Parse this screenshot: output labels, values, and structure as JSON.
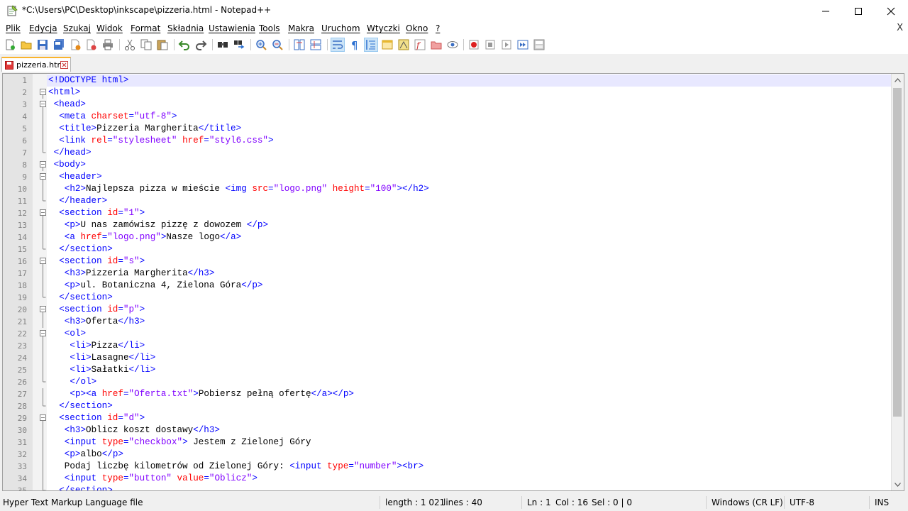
{
  "window": {
    "title": "*C:\\Users\\PC\\Desktop\\inkscape\\pizzeria.html - Notepad++",
    "icons": [
      "minimize-icon",
      "maximize-icon",
      "close-icon"
    ]
  },
  "menu": {
    "items": [
      "Plik",
      "Edycja",
      "Szukaj",
      "Widok",
      "Format",
      "Składnia",
      "Ustawienia",
      "Tools",
      "Makra",
      "Uruchom",
      "Wtyczki",
      "Okno",
      "?"
    ],
    "close": "X"
  },
  "toolbar": {
    "icons": [
      "new-file-icon",
      "open-file-icon",
      "save-icon",
      "save-all-icon",
      "close-icon",
      "close-all-icon",
      "print-icon",
      "cut-icon",
      "copy-icon",
      "paste-icon",
      "undo-icon",
      "redo-icon",
      "find-icon",
      "replace-icon",
      "zoom-in-icon",
      "zoom-out-icon",
      "sync-vertical-icon",
      "sync-horizontal-icon",
      "word-wrap-icon",
      "show-all-chars-icon",
      "indent-guide-icon",
      "user-defined-lang-icon",
      "document-map-icon",
      "function-list-icon",
      "folder-workspace-icon",
      "monitoring-icon",
      "record-macro-icon",
      "stop-record-icon",
      "play-macro-icon",
      "run-macro-multiple-icon",
      "save-macro-icon"
    ]
  },
  "tab": {
    "label": "pizzeria.html",
    "accent": "#fab42d"
  },
  "editor": {
    "current_line": 1,
    "lines": [
      {
        "n": "1",
        "indent": 0,
        "fold": "",
        "tokens": [
          [
            "doc",
            "<!DOCTYPE html>"
          ]
        ]
      },
      {
        "n": "2",
        "indent": 0,
        "fold": "minus",
        "tokens": [
          [
            "tag",
            "<html>"
          ]
        ]
      },
      {
        "n": "3",
        "indent": 1,
        "fold": "minus",
        "tokens": [
          [
            "tag",
            "<head>"
          ]
        ]
      },
      {
        "n": "4",
        "indent": 2,
        "fold": "line",
        "tokens": [
          [
            "tag",
            "<meta "
          ],
          [
            "attr",
            "charset"
          ],
          [
            "tag",
            "="
          ],
          [
            "str",
            "\"utf-8\""
          ],
          [
            "tag",
            ">"
          ]
        ]
      },
      {
        "n": "5",
        "indent": 2,
        "fold": "line",
        "tokens": [
          [
            "tag",
            "<title>"
          ],
          [
            "txt",
            "Pizzeria Margherita"
          ],
          [
            "tag",
            "</title>"
          ]
        ]
      },
      {
        "n": "6",
        "indent": 2,
        "fold": "line",
        "tokens": [
          [
            "tag",
            "<link "
          ],
          [
            "attr",
            "rel"
          ],
          [
            "tag",
            "="
          ],
          [
            "str",
            "\"stylesheet\""
          ],
          [
            "tag",
            " "
          ],
          [
            "attr",
            "href"
          ],
          [
            "tag",
            "="
          ],
          [
            "str",
            "\"styl6.css\""
          ],
          [
            "tag",
            ">"
          ]
        ]
      },
      {
        "n": "7",
        "indent": 1,
        "fold": "end",
        "tokens": [
          [
            "tag",
            "</head>"
          ]
        ]
      },
      {
        "n": "8",
        "indent": 1,
        "fold": "minus",
        "tokens": [
          [
            "tag",
            "<body>"
          ]
        ]
      },
      {
        "n": "9",
        "indent": 2,
        "fold": "minus",
        "tokens": [
          [
            "tag",
            "<header>"
          ]
        ]
      },
      {
        "n": "10",
        "indent": 3,
        "fold": "line",
        "tokens": [
          [
            "tag",
            "<h2>"
          ],
          [
            "txt",
            "Najlepsza pizza w mieście "
          ],
          [
            "tag",
            "<img "
          ],
          [
            "attr",
            "src"
          ],
          [
            "tag",
            "="
          ],
          [
            "str",
            "\"logo.png\""
          ],
          [
            "tag",
            " "
          ],
          [
            "attr",
            "height"
          ],
          [
            "tag",
            "="
          ],
          [
            "str",
            "\"100\""
          ],
          [
            "tag",
            "></h2>"
          ]
        ]
      },
      {
        "n": "11",
        "indent": 2,
        "fold": "end",
        "tokens": [
          [
            "tag",
            "</header>"
          ]
        ]
      },
      {
        "n": "12",
        "indent": 2,
        "fold": "minus",
        "tokens": [
          [
            "tag",
            "<section "
          ],
          [
            "attr",
            "id"
          ],
          [
            "tag",
            "="
          ],
          [
            "str",
            "\"1\""
          ],
          [
            "tag",
            ">"
          ]
        ]
      },
      {
        "n": "13",
        "indent": 3,
        "fold": "line",
        "tokens": [
          [
            "tag",
            "<p>"
          ],
          [
            "txt",
            "U nas zamówisz pizzę z dowozem "
          ],
          [
            "tag",
            "</p>"
          ]
        ]
      },
      {
        "n": "14",
        "indent": 3,
        "fold": "line",
        "tokens": [
          [
            "tag",
            "<a "
          ],
          [
            "attr",
            "href"
          ],
          [
            "tag",
            "="
          ],
          [
            "str",
            "\"logo.png\""
          ],
          [
            "tag",
            ">"
          ],
          [
            "txt",
            "Nasze logo"
          ],
          [
            "tag",
            "</a>"
          ]
        ]
      },
      {
        "n": "15",
        "indent": 2,
        "fold": "end",
        "tokens": [
          [
            "tag",
            "</section>"
          ]
        ]
      },
      {
        "n": "16",
        "indent": 2,
        "fold": "minus",
        "tokens": [
          [
            "tag",
            "<section "
          ],
          [
            "attr",
            "id"
          ],
          [
            "tag",
            "="
          ],
          [
            "str",
            "\"s\""
          ],
          [
            "tag",
            ">"
          ]
        ]
      },
      {
        "n": "17",
        "indent": 3,
        "fold": "line",
        "tokens": [
          [
            "tag",
            "<h3>"
          ],
          [
            "txt",
            "Pizzeria Margherita"
          ],
          [
            "tag",
            "</h3>"
          ]
        ]
      },
      {
        "n": "18",
        "indent": 3,
        "fold": "line",
        "tokens": [
          [
            "tag",
            "<p>"
          ],
          [
            "txt",
            "ul. Botaniczna 4, Zielona Góra"
          ],
          [
            "tag",
            "</p>"
          ]
        ]
      },
      {
        "n": "19",
        "indent": 2,
        "fold": "end",
        "tokens": [
          [
            "tag",
            "</section>"
          ]
        ]
      },
      {
        "n": "20",
        "indent": 2,
        "fold": "minus",
        "tokens": [
          [
            "tag",
            "<section "
          ],
          [
            "attr",
            "id"
          ],
          [
            "tag",
            "="
          ],
          [
            "str",
            "\"p\""
          ],
          [
            "tag",
            ">"
          ]
        ]
      },
      {
        "n": "21",
        "indent": 3,
        "fold": "line",
        "tokens": [
          [
            "tag",
            "<h3>"
          ],
          [
            "txt",
            "Oferta"
          ],
          [
            "tag",
            "</h3>"
          ]
        ]
      },
      {
        "n": "22",
        "indent": 3,
        "fold": "minus",
        "tokens": [
          [
            "tag",
            "<ol>"
          ]
        ]
      },
      {
        "n": "23",
        "indent": 4,
        "fold": "line",
        "tokens": [
          [
            "tag",
            "<li>"
          ],
          [
            "txt",
            "Pizza"
          ],
          [
            "tag",
            "</li>"
          ]
        ]
      },
      {
        "n": "24",
        "indent": 4,
        "fold": "line",
        "tokens": [
          [
            "tag",
            "<li>"
          ],
          [
            "txt",
            "Lasagne"
          ],
          [
            "tag",
            "</li>"
          ]
        ]
      },
      {
        "n": "25",
        "indent": 4,
        "fold": "line",
        "tokens": [
          [
            "tag",
            "<li>"
          ],
          [
            "txt",
            "Sałatki"
          ],
          [
            "tag",
            "</li>"
          ]
        ]
      },
      {
        "n": "26",
        "indent": 4,
        "fold": "end",
        "tokens": [
          [
            "tag",
            "</ol>"
          ]
        ]
      },
      {
        "n": "27",
        "indent": 4,
        "fold": "line",
        "tokens": [
          [
            "tag",
            "<p><a "
          ],
          [
            "attr",
            "href"
          ],
          [
            "tag",
            "="
          ],
          [
            "str",
            "\"Oferta.txt\""
          ],
          [
            "tag",
            ">"
          ],
          [
            "txt",
            "Pobiersz pełną ofertę"
          ],
          [
            "tag",
            "</a></p>"
          ]
        ]
      },
      {
        "n": "28",
        "indent": 2,
        "fold": "end",
        "tokens": [
          [
            "tag",
            "</section>"
          ]
        ]
      },
      {
        "n": "29",
        "indent": 2,
        "fold": "minus",
        "tokens": [
          [
            "tag",
            "<section "
          ],
          [
            "attr",
            "id"
          ],
          [
            "tag",
            "="
          ],
          [
            "str",
            "\"d\""
          ],
          [
            "tag",
            ">"
          ]
        ]
      },
      {
        "n": "30",
        "indent": 3,
        "fold": "line",
        "tokens": [
          [
            "tag",
            "<h3>"
          ],
          [
            "txt",
            "Oblicz koszt dostawy"
          ],
          [
            "tag",
            "</h3>"
          ]
        ]
      },
      {
        "n": "31",
        "indent": 3,
        "fold": "line",
        "tokens": [
          [
            "tag",
            "<input "
          ],
          [
            "attr",
            "type"
          ],
          [
            "tag",
            "="
          ],
          [
            "str",
            "\"checkbox\""
          ],
          [
            "tag",
            ">"
          ],
          [
            "txt",
            " Jestem z Zielonej Góry"
          ]
        ]
      },
      {
        "n": "32",
        "indent": 3,
        "fold": "line",
        "tokens": [
          [
            "tag",
            "<p>"
          ],
          [
            "txt",
            "albo"
          ],
          [
            "tag",
            "</p>"
          ]
        ]
      },
      {
        "n": "33",
        "indent": 3,
        "fold": "line",
        "tokens": [
          [
            "txt",
            "Podaj liczbę kilometrów od Zielonej Góry: "
          ],
          [
            "tag",
            "<input "
          ],
          [
            "attr",
            "type"
          ],
          [
            "tag",
            "="
          ],
          [
            "str",
            "\"number\""
          ],
          [
            "tag",
            "><br>"
          ]
        ]
      },
      {
        "n": "34",
        "indent": 3,
        "fold": "line",
        "tokens": [
          [
            "tag",
            "<input "
          ],
          [
            "attr",
            "type"
          ],
          [
            "tag",
            "="
          ],
          [
            "str",
            "\"button\""
          ],
          [
            "tag",
            " "
          ],
          [
            "attr",
            "value"
          ],
          [
            "tag",
            "="
          ],
          [
            "str",
            "\"Oblicz\""
          ],
          [
            "tag",
            ">"
          ]
        ]
      },
      {
        "n": "35",
        "indent": 2,
        "fold": "end",
        "tokens": [
          [
            "tag",
            "</section>"
          ]
        ]
      }
    ]
  },
  "status": {
    "file_type": "Hyper Text Markup Language file",
    "length": "length : 1 021",
    "lines": "lines : 40",
    "ln": "Ln : 1",
    "col": "Col : 16",
    "sel": "Sel : 0 | 0",
    "eol": "Windows (CR LF)",
    "encoding": "UTF-8",
    "mode": "INS"
  },
  "colors": {
    "tag": "#0000ff",
    "attr": "#ff0000",
    "string": "#8000ff",
    "current_line": "#e8e8ff"
  }
}
